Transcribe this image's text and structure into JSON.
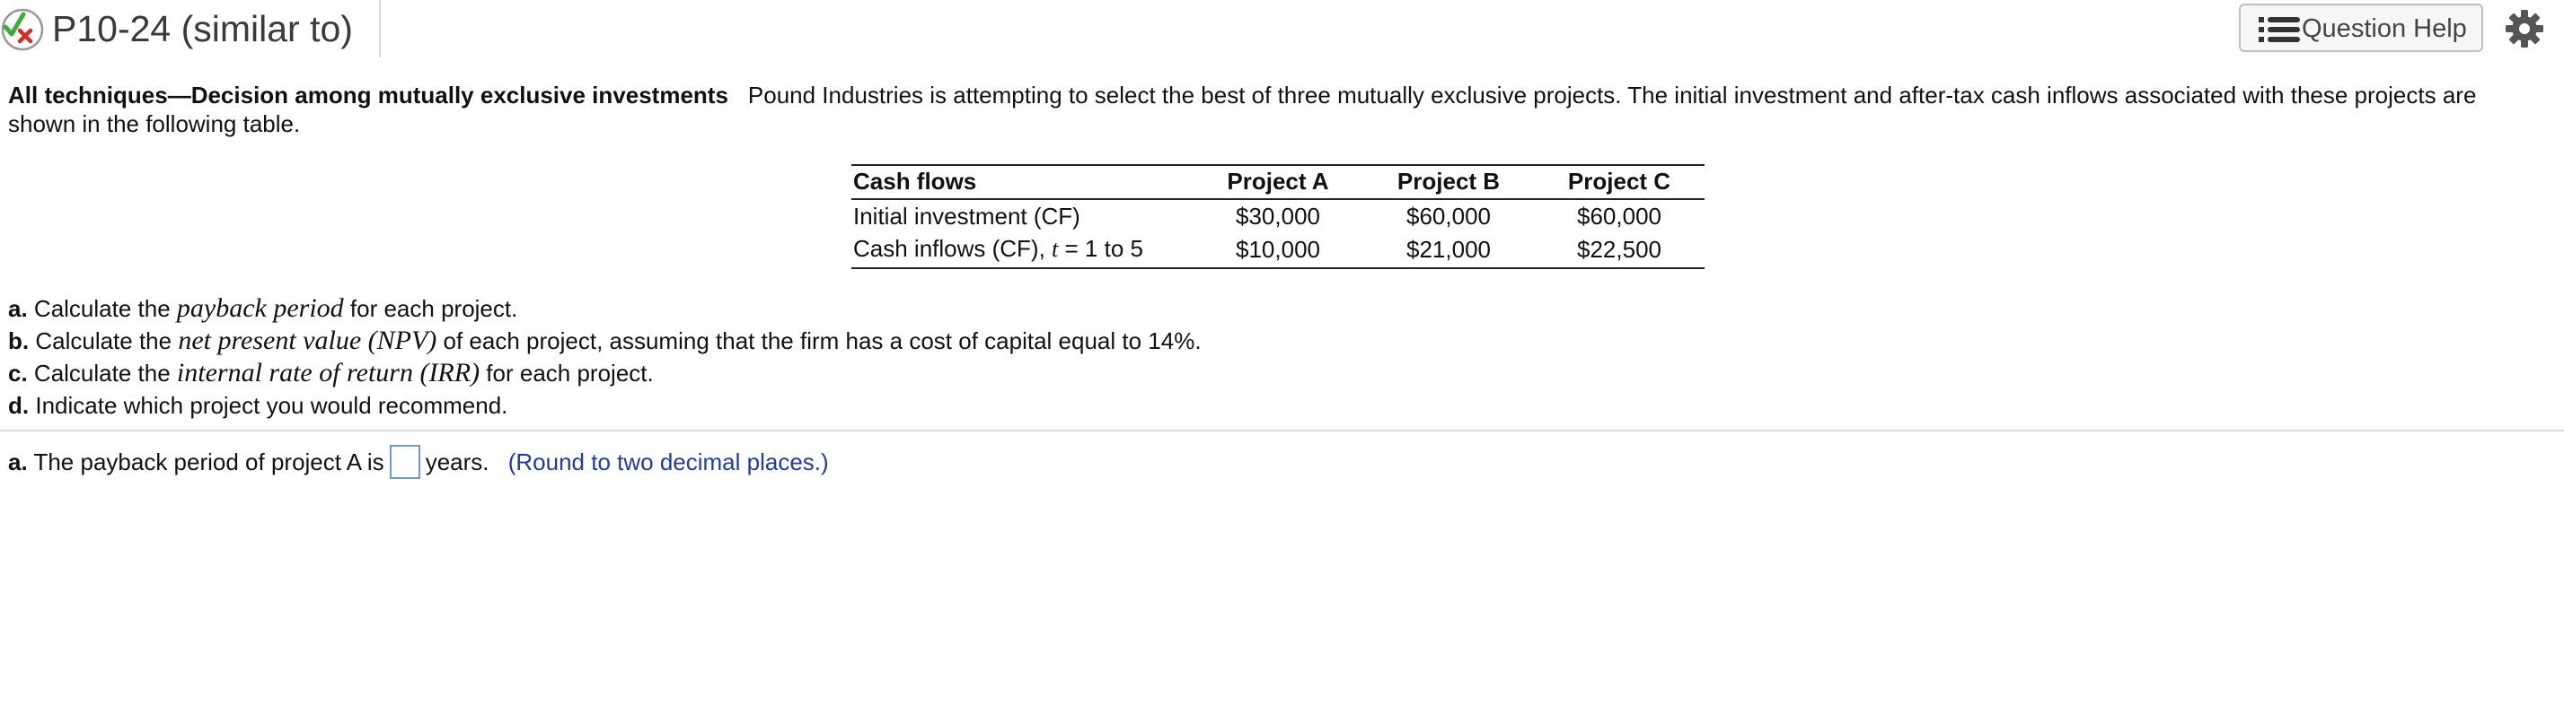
{
  "header": {
    "title": "P10-24 (similar to)",
    "status_icon": "check-cross-icon",
    "help_label": "Question Help",
    "help_icon": "list-icon",
    "settings_icon": "gear-icon"
  },
  "statement": {
    "heading": "All techniques—Decision among mutually exclusive investments",
    "body": "Pound Industries is attempting to select the best of three mutually exclusive projects.  The initial investment and after-tax cash inflows associated with these projects are shown in the following table."
  },
  "table": {
    "headers": [
      "Cash flows",
      "Project A",
      "Project B",
      "Project C"
    ],
    "rows": [
      {
        "label": "Initial investment (CF)",
        "values": [
          "$30,000",
          "$60,000",
          "$60,000"
        ]
      },
      {
        "label_pre": "Cash inflows (CF), ",
        "label_var": "t",
        "label_post": " = 1 to 5",
        "values": [
          "$10,000",
          "$21,000",
          "$22,500"
        ]
      }
    ]
  },
  "parts": [
    {
      "label": "a.",
      "pre": "Calculate the ",
      "term": "payback period",
      "post": " for each project."
    },
    {
      "label": "b.",
      "pre": "Calculate the ",
      "term": "net present value (NPV)",
      "post": " of each project, assuming that the firm has a cost of capital equal to 14%."
    },
    {
      "label": "c.",
      "pre": "Calculate the ",
      "term": "internal rate of return (IRR)",
      "post": " for each project."
    },
    {
      "label": "d.",
      "pre": "Indicate which project you would recommend.",
      "term": "",
      "post": ""
    }
  ],
  "answer": {
    "label": "a.",
    "pre": "The payback period of project A is",
    "value": "",
    "post": "years.",
    "hint": "(Round to two decimal places.)"
  },
  "colors": {
    "hint": "#1b3f9a",
    "input_border": "#6b9bd1",
    "check_green": "#3cab3c",
    "cross_red": "#d62b2b"
  }
}
